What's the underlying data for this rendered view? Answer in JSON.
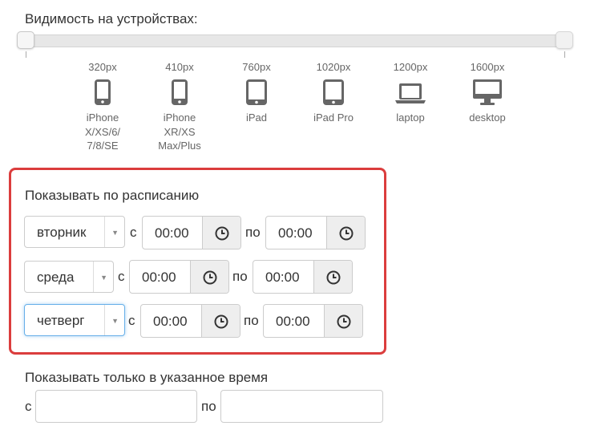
{
  "visibility": {
    "title": "Видимость на устройствах:",
    "devices": [
      {
        "px": "320px",
        "icon": "phone-icon",
        "name_lines": [
          "iPhone",
          "X/XS/6/",
          "7/8/SE"
        ]
      },
      {
        "px": "410px",
        "icon": "phone-icon",
        "name_lines": [
          "iPhone",
          "XR/XS",
          "Max/Plus"
        ]
      },
      {
        "px": "760px",
        "icon": "tablet-icon",
        "name_lines": [
          "iPad"
        ]
      },
      {
        "px": "1020px",
        "icon": "tablet-icon",
        "name_lines": [
          "iPad Pro"
        ]
      },
      {
        "px": "1200px",
        "icon": "laptop-icon",
        "name_lines": [
          "laptop"
        ]
      },
      {
        "px": "1600px",
        "icon": "desktop-icon",
        "name_lines": [
          "desktop"
        ]
      }
    ]
  },
  "schedule": {
    "title": "Показывать по расписанию",
    "from_label": "с",
    "to_label": "по",
    "rows": [
      {
        "day": "вторник",
        "from": "00:00",
        "to": "00:00",
        "focused": false
      },
      {
        "day": "среда",
        "from": "00:00",
        "to": "00:00",
        "focused": false
      },
      {
        "day": "четверг",
        "from": "00:00",
        "to": "00:00",
        "focused": true
      }
    ]
  },
  "time_only": {
    "title": "Показывать только в указанное время",
    "from_label": "с",
    "to_label": "по"
  },
  "colors": {
    "highlight_border": "#db3d3d",
    "focus_border": "#66afe9"
  }
}
